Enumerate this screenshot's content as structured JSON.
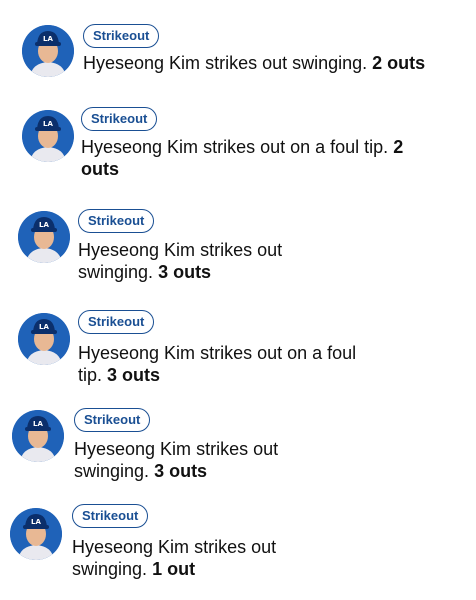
{
  "colors": {
    "badge_border": "#1a4f93",
    "avatar_bg": "#1f62b8",
    "text": "#111111"
  },
  "plays": [
    {
      "badge": "Strikeout",
      "player": "Hyeseong Kim",
      "action": "strikes out swinging.",
      "outs": "2 outs",
      "avatar_icon": "player-headshot-icon"
    },
    {
      "badge": "Strikeout",
      "player": "Hyeseong Kim",
      "action": "strikes out on a foul tip.",
      "outs": "2 outs",
      "avatar_icon": "player-headshot-icon"
    },
    {
      "badge": "Strikeout",
      "player": "Hyeseong Kim",
      "action": "strikes out swinging.",
      "outs": "3 outs",
      "avatar_icon": "player-headshot-icon"
    },
    {
      "badge": "Strikeout",
      "player": "Hyeseong Kim",
      "action": "strikes out on a foul tip.",
      "outs": "3 outs",
      "avatar_icon": "player-headshot-icon"
    },
    {
      "badge": "Strikeout",
      "player": "Hyeseong Kim",
      "action": "strikes out swinging.",
      "outs": "3 outs",
      "avatar_icon": "player-headshot-icon"
    },
    {
      "badge": "Strikeout",
      "player": "Hyeseong Kim",
      "action": "strikes out swinging.",
      "outs": "1 out",
      "avatar_icon": "player-headshot-icon"
    }
  ]
}
